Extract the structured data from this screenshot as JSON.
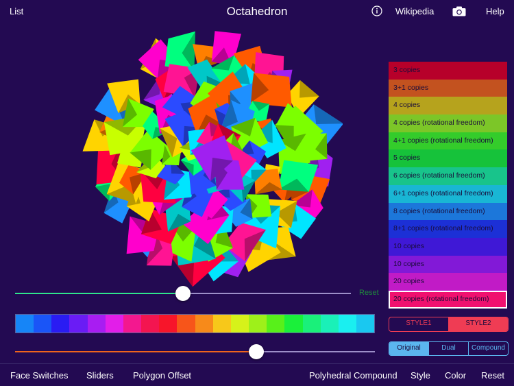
{
  "header": {
    "list_label": "List",
    "title": "Octahedron",
    "info_icon": "info-circle-icon",
    "wikipedia_label": "Wikipedia",
    "camera_icon": "camera-icon",
    "help_label": "Help"
  },
  "compound_list": {
    "items": [
      {
        "label": "3 copies",
        "color": "#b7002a"
      },
      {
        "label": "3+1 copies",
        "color": "#c3521f"
      },
      {
        "label": "4 copies",
        "color": "#b6a31d"
      },
      {
        "label": "4 copies (rotational freedom)",
        "color": "#7cc628"
      },
      {
        "label": "4+1 copies (rotational freedom)",
        "color": "#34cc2b"
      },
      {
        "label": "5 copies",
        "color": "#16c23a"
      },
      {
        "label": "6 copies (rotational freedom)",
        "color": "#18c48b"
      },
      {
        "label": "6+1 copies (rotational freedom)",
        "color": "#19b6d4"
      },
      {
        "label": "8 copies (rotational freedom)",
        "color": "#1c77da"
      },
      {
        "label": "8+1 copies (rotational freedom)",
        "color": "#1c30d6"
      },
      {
        "label": "10 copies",
        "color": "#3f18d6"
      },
      {
        "label": "10 copies",
        "color": "#8219d7"
      },
      {
        "label": "20 copies",
        "color": "#c11bc6"
      },
      {
        "label": "20 copies (rotational freedom)",
        "color": "#f0106f"
      }
    ],
    "selected_index": 13
  },
  "top_slider": {
    "value": 0.5,
    "left_color": "#2fe58c",
    "right_color": "#9d8fc9"
  },
  "reset_small_label": "Reset",
  "palette": [
    "#1685f7",
    "#1a55f7",
    "#2a1cf3",
    "#6a1cf5",
    "#a81df2",
    "#e21ee9",
    "#f3188f",
    "#f31550",
    "#f7152a",
    "#f7551a",
    "#f78a1a",
    "#f7c81a",
    "#d6f21a",
    "#9ef01a",
    "#58f01a",
    "#1af03a",
    "#1af07a",
    "#1af0b8",
    "#1aeff0",
    "#1ac8f0"
  ],
  "bottom_slider": {
    "value": 0.67,
    "left_color": "#f0641c",
    "right_color": "#9d8fc9"
  },
  "style_toggle": {
    "options": [
      "STYLE1",
      "STYLE2"
    ],
    "selected": "STYLE2",
    "accent": "#ef3c54"
  },
  "view_toggle": {
    "options": [
      "Original",
      "Dual",
      "Compound"
    ],
    "selected": "Original",
    "accent": "#5bb6ef"
  },
  "footer": {
    "face_switches": "Face Switches",
    "sliders": "Sliders",
    "polygon_offset": "Polygon Offset",
    "polyhedral_compound": "Polyhedral Compound",
    "style": "Style",
    "color": "Color",
    "reset": "Reset"
  }
}
